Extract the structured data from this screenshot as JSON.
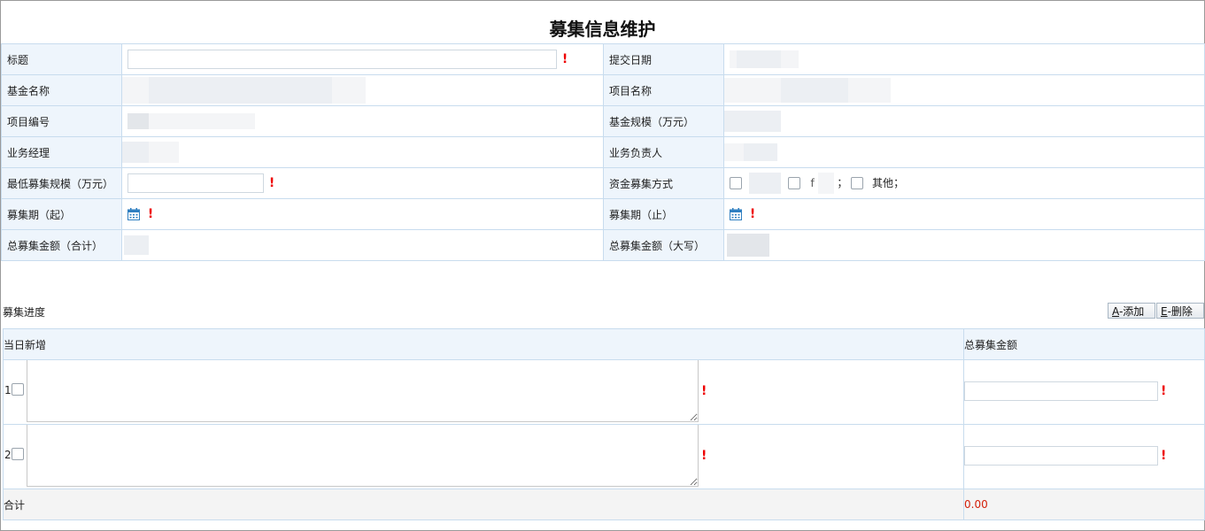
{
  "page": {
    "title": "募集信息维护"
  },
  "form": {
    "title_label": "标题",
    "submit_date_label": "提交日期",
    "fund_name_label": "基金名称",
    "project_name_label": "项目名称",
    "project_no_label": "项目编号",
    "fund_scale_label": "基金规模（万元）",
    "business_manager_label": "业务经理",
    "business_owner_label": "业务负责人",
    "min_scale_label": "最低募集规模（万元）",
    "fund_method_label": "资金募集方式",
    "fund_method_other": "其他",
    "fund_method_sep": "；",
    "fund_method_partial": "f",
    "period_start_label": "募集期（起）",
    "period_end_label": "募集期（止）",
    "total_amount_label": "总募集金额（合计）",
    "total_amount_caps_label": "总募集金额（大写）",
    "required_mark": "!"
  },
  "progress": {
    "title": "募集进度",
    "add_key": "A",
    "add_label": "-添加",
    "delete_key": "E",
    "delete_label": "-删除",
    "col_daily": "当日新增",
    "col_total": "总募集金额",
    "rows": [
      {
        "index": "1"
      },
      {
        "index": "2"
      }
    ],
    "sum_label": "合计",
    "sum_value": "0.00"
  },
  "icons": {
    "calendar": "calendar-icon",
    "checkbox": "checkbox-icon",
    "resize": "resize-grip-icon"
  },
  "colors": {
    "label_bg": "#eef5fc",
    "border": "#c8dcee",
    "required": "#e00000",
    "total": "#d4200a"
  }
}
